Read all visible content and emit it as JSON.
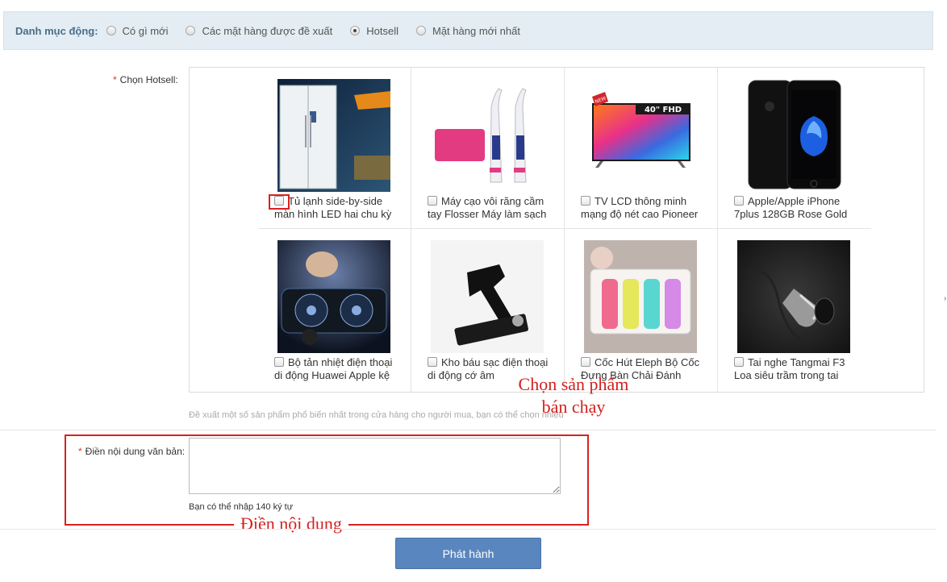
{
  "category": {
    "label": "Danh mục động:",
    "options": [
      {
        "label": "Có gì mới",
        "checked": false
      },
      {
        "label": "Các mặt hàng được đề xuất",
        "checked": false
      },
      {
        "label": "Hotsell",
        "checked": true
      },
      {
        "label": "Mặt hàng mới nhất",
        "checked": false
      }
    ]
  },
  "hotsell": {
    "required_mark": "*",
    "label": "Chọn Hotsell:",
    "products": [
      {
        "name": "Tủ lạnh side-by-side màn hình LED hai chu kỳ",
        "icon": "fridge"
      },
      {
        "name": "Máy cạo vôi răng cầm tay Flosser Máy làm sạch",
        "icon": "water-flosser"
      },
      {
        "name": "TV LCD thông minh mạng độ nét cao Pioneer",
        "icon": "tv",
        "tv_badge": "40\" FHD",
        "new_badge": "NEW"
      },
      {
        "name": "Apple/Apple iPhone 7plus 128GB Rose Gold",
        "icon": "iphone"
      },
      {
        "name": "Bộ tản nhiệt điện thoại di động Huawei Apple kệ",
        "icon": "phone-cooler"
      },
      {
        "name": "Kho báu sạc điện thoại di động cớ âm",
        "icon": "phone-stand-powerbank"
      },
      {
        "name": "Cốc Hút Eleph Bộ Cốc Đựng Bàn Chải Đánh",
        "icon": "toothbrush-holder"
      },
      {
        "name": "Tai nghe Tangmai F3 Loa siêu trầm trong tai",
        "icon": "earphone"
      }
    ],
    "hint": "Đề xuất một số sản phẩm phổ biến nhất trong cửa hàng cho người mua, bạn có thể chọn nhiều"
  },
  "annotations": {
    "pick_line1": "Chọn sản phẩm",
    "pick_line2": "bán chạy",
    "content": "Điền nội dung"
  },
  "content": {
    "required_mark": "*",
    "label": "Điền nội dung văn bản:",
    "value": "",
    "hint": "Bạn có thể nhập 140 ký tự"
  },
  "publish_label": "Phát hành",
  "edge_glyph": "›"
}
